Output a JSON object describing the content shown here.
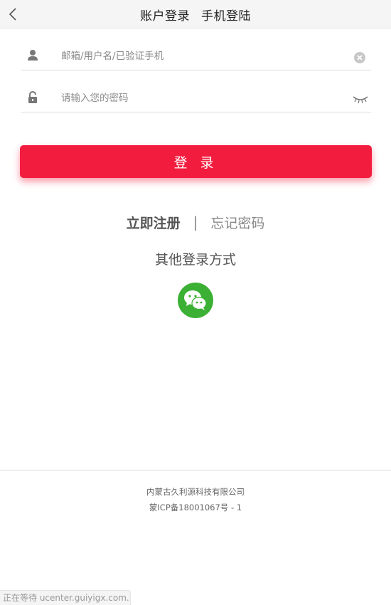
{
  "header": {
    "tabs": [
      "账户登录",
      "手机登陆"
    ]
  },
  "form": {
    "username_placeholder": "邮箱/用户名/已验证手机",
    "username_value": "",
    "password_placeholder": "请输入您的密码",
    "password_value": "",
    "login_label": "登 录"
  },
  "links": {
    "register": "立即注册",
    "separator": "|",
    "forgot": "忘记密码"
  },
  "other_login": {
    "title": "其他登录方式",
    "methods": [
      "wechat-icon"
    ]
  },
  "footer": {
    "company": "内蒙古久利源科技有限公司",
    "icp": "蒙ICP备18001067号 - 1"
  },
  "status_bar": {
    "text": "正在等待 ucenter.guiyigx.com..."
  },
  "colors": {
    "accent": "#f21c3e",
    "wechat": "#3cb034",
    "header_bg": "#f5f5f5"
  }
}
